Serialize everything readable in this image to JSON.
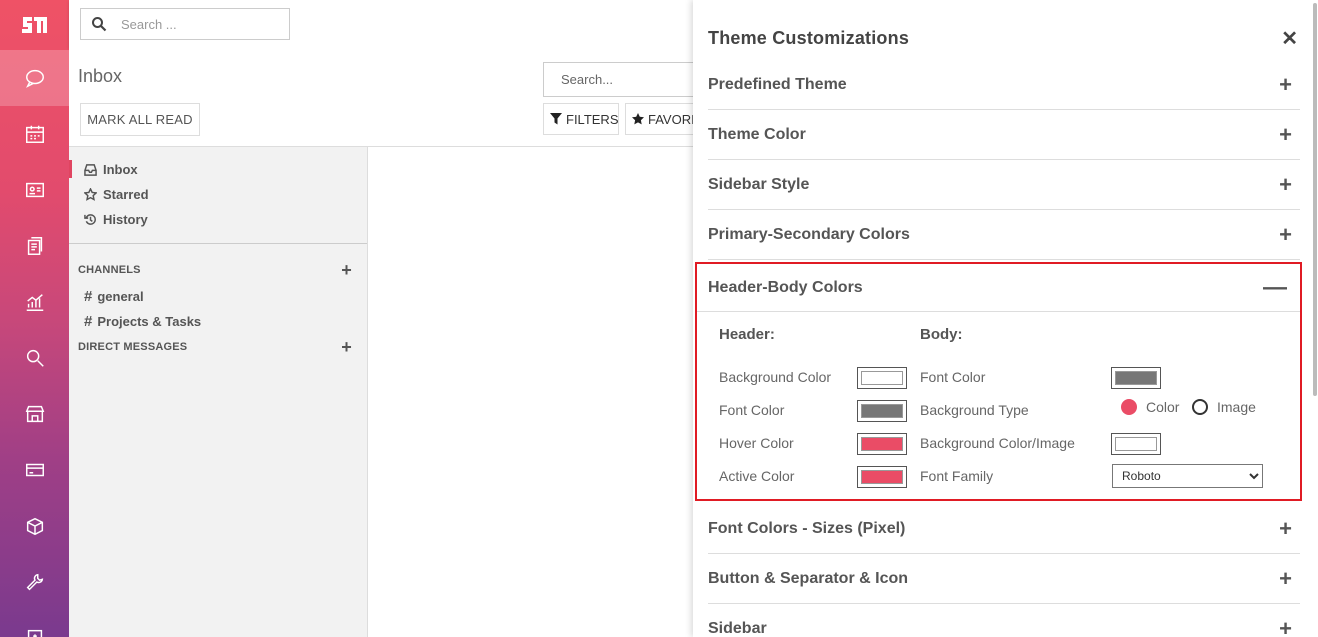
{
  "top_search": {
    "placeholder": "Search ..."
  },
  "control": {
    "title": "Inbox",
    "mark_all_read": "MARK ALL READ",
    "search_placeholder": "Search...",
    "filters": "FILTERS",
    "favorites": "FAVORITES"
  },
  "mailbox": [
    {
      "label": "Inbox",
      "icon": "inbox-icon"
    },
    {
      "label": "Starred",
      "icon": "star-icon"
    },
    {
      "label": "History",
      "icon": "history-icon"
    }
  ],
  "channels": {
    "title": "CHANNELS",
    "items": [
      "general",
      "Projects & Tasks"
    ]
  },
  "direct_messages": {
    "title": "DIRECT MESSAGES"
  },
  "theme": {
    "title": "Theme Customizations",
    "sections_top": [
      "Predefined Theme",
      "Theme Color",
      "Sidebar Style",
      "Primary-Secondary Colors"
    ],
    "open_section": "Header-Body Colors",
    "header": {
      "title": "Header:",
      "rows": [
        {
          "label": "Background Color",
          "color": "#ffffff"
        },
        {
          "label": "Font Color",
          "color": "#777777"
        },
        {
          "label": "Hover Color",
          "color": "#ea4c66"
        },
        {
          "label": "Active Color",
          "color": "#ea4c66"
        }
      ]
    },
    "body": {
      "title": "Body:",
      "font_color_label": "Font Color",
      "font_color": "#777777",
      "background_type_label": "Background Type",
      "background_type_options": [
        "Color",
        "Image"
      ],
      "background_type_selected": "Color",
      "background_color_label": "Background Color/Image",
      "background_color": "#ffffff",
      "font_family_label": "Font Family",
      "font_family_value": "Roboto"
    },
    "sections_bottom": [
      "Font Colors - Sizes (Pixel)",
      "Button & Separator & Icon",
      "Sidebar"
    ]
  },
  "colors": {
    "accent": "#e04561",
    "highlight_border": "#e01b24"
  }
}
